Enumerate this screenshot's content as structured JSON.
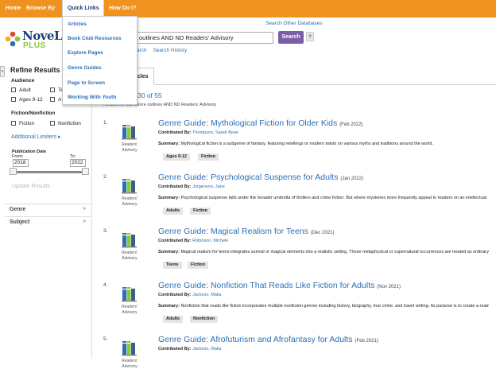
{
  "nav": {
    "home": "Home",
    "browse_by": "Browse By",
    "quick_links": "Quick Links",
    "how_do_i": "How Do I?"
  },
  "quick_links_menu": [
    "Articles",
    "Book Club Resources",
    "Explore Pages",
    "Genre Guides",
    "Page to Screen",
    "Working With Youth"
  ],
  "logo": {
    "name": "NoveList",
    "edition": "PLUS"
  },
  "header": {
    "search_other": "Search Other Databases",
    "search_value": "outlines AND ND Readers' Advisory",
    "search_button": "Search",
    "help": "?",
    "link_search": "arch",
    "link_history": "Search History"
  },
  "sidebar": {
    "title": "Refine Results",
    "collapse": "«",
    "audience_heading": "Audience",
    "audience": [
      "Adult",
      "Te",
      "Ages 9-12",
      "A"
    ],
    "fiction_heading": "Fiction/Nonfiction",
    "fiction": [
      "Fiction",
      "Nonfiction"
    ],
    "additional_limiters": "Additional Limiters",
    "pub_date_label": "Publication Date",
    "from_label": "From:",
    "to_label": "To:",
    "from_year": "2018",
    "to_year": "2022",
    "update_button": "Update Results",
    "facets": [
      {
        "label": "Genre",
        "arrow": "»"
      },
      {
        "label": "Subject",
        "arrow": "»"
      }
    ]
  },
  "main": {
    "tab": "icles",
    "count": "30 of 55",
    "results_for": "Results for: DE Genre outlines AND ND Readers' Advisory",
    "contributed_label": "Contributed By:",
    "summary_label": "Summary:",
    "results": [
      {
        "num": "1.",
        "type": "Readers' Advisory",
        "title": "Genre Guide: Mythological Fiction for Older Kids",
        "date": "(Feb 2022)",
        "contributor": "Thompson, Sarah Bean",
        "summary": "Mythological fiction is a subgenre of fantasy, featuring retellings or modern twists on various myths and traditions around the world.",
        "tags": [
          "Ages 9-12",
          "Fiction"
        ]
      },
      {
        "num": "2.",
        "type": "Readers' Advisory",
        "title": "Genre Guide: Psychological Suspense for Adults",
        "date": "(Jan 2022)",
        "contributor": "Jorgenson, Jane",
        "summary": "Psychological suspense falls under the broader umbrella of thrillers and crime fiction. But where mysteries more frequently appeal to readers on an intellectual",
        "tags": [
          "Adults",
          "Fiction"
        ]
      },
      {
        "num": "3.",
        "type": "Readers' Advisory",
        "title": "Genre Guide: Magical Realism for Teens",
        "date": "(Dec 2021)",
        "contributor": "Robinson, Michele",
        "summary": "Magical realism for teens integrates surreal or magical elements into a realistic setting. These metaphysical or supernatural occurrences are treated as ordinary",
        "tags": [
          "Teens",
          "Fiction"
        ]
      },
      {
        "num": "4.",
        "type": "Readers' Advisory",
        "title": "Genre Guide: Nonfiction That Reads Like Fiction for Adults",
        "date": "(Nov 2021)",
        "contributor": "Jackson, Malia",
        "summary": "Nonfiction that reads like fiction incorporates multiple nonfiction genres including history, biography, true crime, and travel writing. Its purpose is to create a read",
        "tags": [
          "Adults",
          "Nonfiction"
        ]
      },
      {
        "num": "5.",
        "type": "Readers' Advisory",
        "title": "Genre Guide: Afrofuturism and Afrofantasy for Adults",
        "date": "(Feb 2021)",
        "contributor": "Jackson, Malia",
        "summary": "",
        "tags": []
      }
    ]
  },
  "colors": {
    "nav_orange": "#f0921f",
    "link_blue": "#2c6fb7",
    "search_purple": "#7b5ea7",
    "brand_navy": "#1b3f73",
    "plus_green": "#8cc63f"
  }
}
